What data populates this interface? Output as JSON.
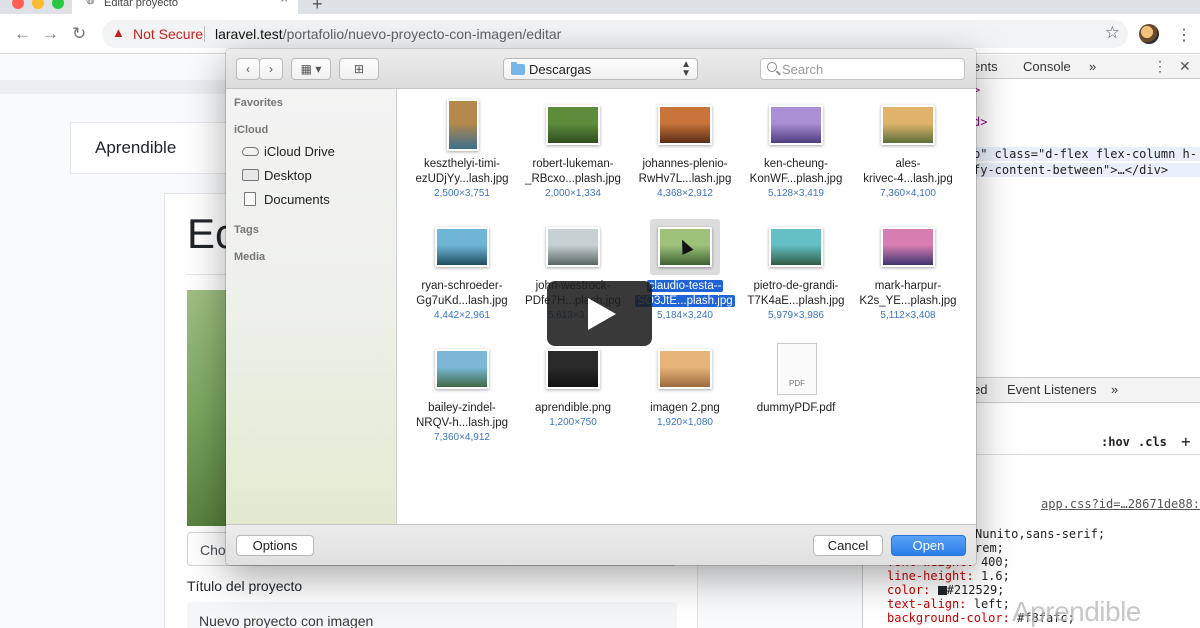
{
  "browser": {
    "tab_title": "Editar proyecto",
    "tab_close": "×",
    "new_tab": "+",
    "security_label": "Not Secure",
    "url_host": "laravel.test",
    "url_path": "/portafolio/nuevo-proyecto-con-imagen/editar",
    "back": "←",
    "forward": "→",
    "reload": "↻",
    "star": "☆",
    "menu": "⋮"
  },
  "webpage": {
    "brand": "Aprendible",
    "heading_partial": "Ec",
    "file_input_label": "Choc",
    "title_label": "Título del proyecto",
    "title_value": "Nuevo proyecto con imagen"
  },
  "devtools": {
    "tabs": [
      "ents",
      "Console",
      "»"
    ],
    "lines": [
      {
        "text": ">"
      },
      {
        "text": "d>"
      },
      {
        "text": "p\" class=\"d-flex flex-column h-"
      },
      {
        "text": "fy-content-between\">…</div>"
      }
    ],
    "panel_tabs": [
      "ed",
      "Event Listeners",
      "»"
    ],
    "filter_hov": ":hov",
    "filter_cls": ".cls",
    "filter_add": "+",
    "stylesheet_link": "app.css?id=…28671de88:8",
    "css_rules": [
      {
        "prop": "",
        "value": "Nunito,sans-serif;"
      },
      {
        "prop": "",
        "value": "rem;"
      },
      {
        "prop": "font-weight:",
        "value": "400;"
      },
      {
        "prop": "line-height:",
        "value": "1.6;"
      },
      {
        "prop": "color:",
        "value": "#212529;"
      },
      {
        "prop": "text-align:",
        "value": "left;"
      },
      {
        "prop": "background-color:",
        "value": "#f8fafc;"
      }
    ],
    "watermark": "Aprendible"
  },
  "dialog": {
    "location": "Descargas",
    "search_placeholder": "Search",
    "sidebar": {
      "favorites_heading": "Favorites",
      "icloud_heading": "iCloud",
      "items": [
        "iCloud Drive",
        "Desktop",
        "Documents"
      ],
      "tags_heading": "Tags",
      "media_heading": "Media"
    },
    "files": [
      {
        "name1": "keszthelyi-timi-",
        "name2": "ezUDjYy...lash.jpg",
        "dims": "2,500×3,751",
        "thumb": "#b5894e",
        "thumb2": "#3c6f8a",
        "portrait": true
      },
      {
        "name1": "robert-lukeman-",
        "name2": "_RBcxo...plash.jpg",
        "dims": "2,000×1,334",
        "thumb": "#5d8c3a",
        "thumb2": "#2f4e22"
      },
      {
        "name1": "johannes-plenio-",
        "name2": "RwHv7L...lash.jpg",
        "dims": "4,368×2,912",
        "thumb": "#c8743a",
        "thumb2": "#5a2c16"
      },
      {
        "name1": "ken-cheung-",
        "name2": "KonWF...plash.jpg",
        "dims": "5,128×3,419",
        "thumb": "#a98fd4",
        "thumb2": "#4d3d7e"
      },
      {
        "name1": "ales-",
        "name2": "krivec-4...lash.jpg",
        "dims": "7,360×4,100",
        "thumb": "#e0b36a",
        "thumb2": "#5c6f3a"
      },
      {
        "name1": "ryan-schroeder-",
        "name2": "Gg7uKd...lash.jpg",
        "dims": "4,442×2,961",
        "thumb": "#6fb6d6",
        "thumb2": "#1f4e62"
      },
      {
        "name1": "john-westrock-",
        "name2": "PDfe7H...plash.jpg",
        "dims": "5,613×3,7..",
        "thumb": "#c9d0d3",
        "thumb2": "#5a6663"
      },
      {
        "name1": "claudio-testa--",
        "name2": "SO3JtE...plash.jpg",
        "dims": "5,184×3,240",
        "thumb": "#9ec27a",
        "thumb2": "#3d6130",
        "selected": true
      },
      {
        "name1": "pietro-de-grandi-",
        "name2": "T7K4aE...plash.jpg",
        "dims": "5,979×3,986",
        "thumb": "#64c0c4",
        "thumb2": "#2e5c44"
      },
      {
        "name1": "mark-harpur-",
        "name2": "K2s_YE...plash.jpg",
        "dims": "5,112×3,408",
        "thumb": "#d87db1",
        "thumb2": "#3d3570"
      },
      {
        "name1": "bailey-zindel-",
        "name2": "NRQV-h...lash.jpg",
        "dims": "7,360×4,912",
        "thumb": "#7ab8d6",
        "thumb2": "#3f6a45"
      },
      {
        "name1": "aprendible.png",
        "name2": "",
        "dims": "1,200×750",
        "thumb": "#2a2a2a",
        "thumb2": "#111111"
      },
      {
        "name1": "imagen 2.png",
        "name2": "",
        "dims": "1,920×1,080",
        "thumb": "#e7b57a",
        "thumb2": "#9b6b3e"
      },
      {
        "name1": "dummyPDF.pdf",
        "name2": "",
        "dims": "",
        "pdf": true,
        "pdf_label": "PDF"
      }
    ],
    "options_label": "Options",
    "cancel_label": "Cancel",
    "open_label": "Open",
    "accent_color": "#2a7de9"
  }
}
